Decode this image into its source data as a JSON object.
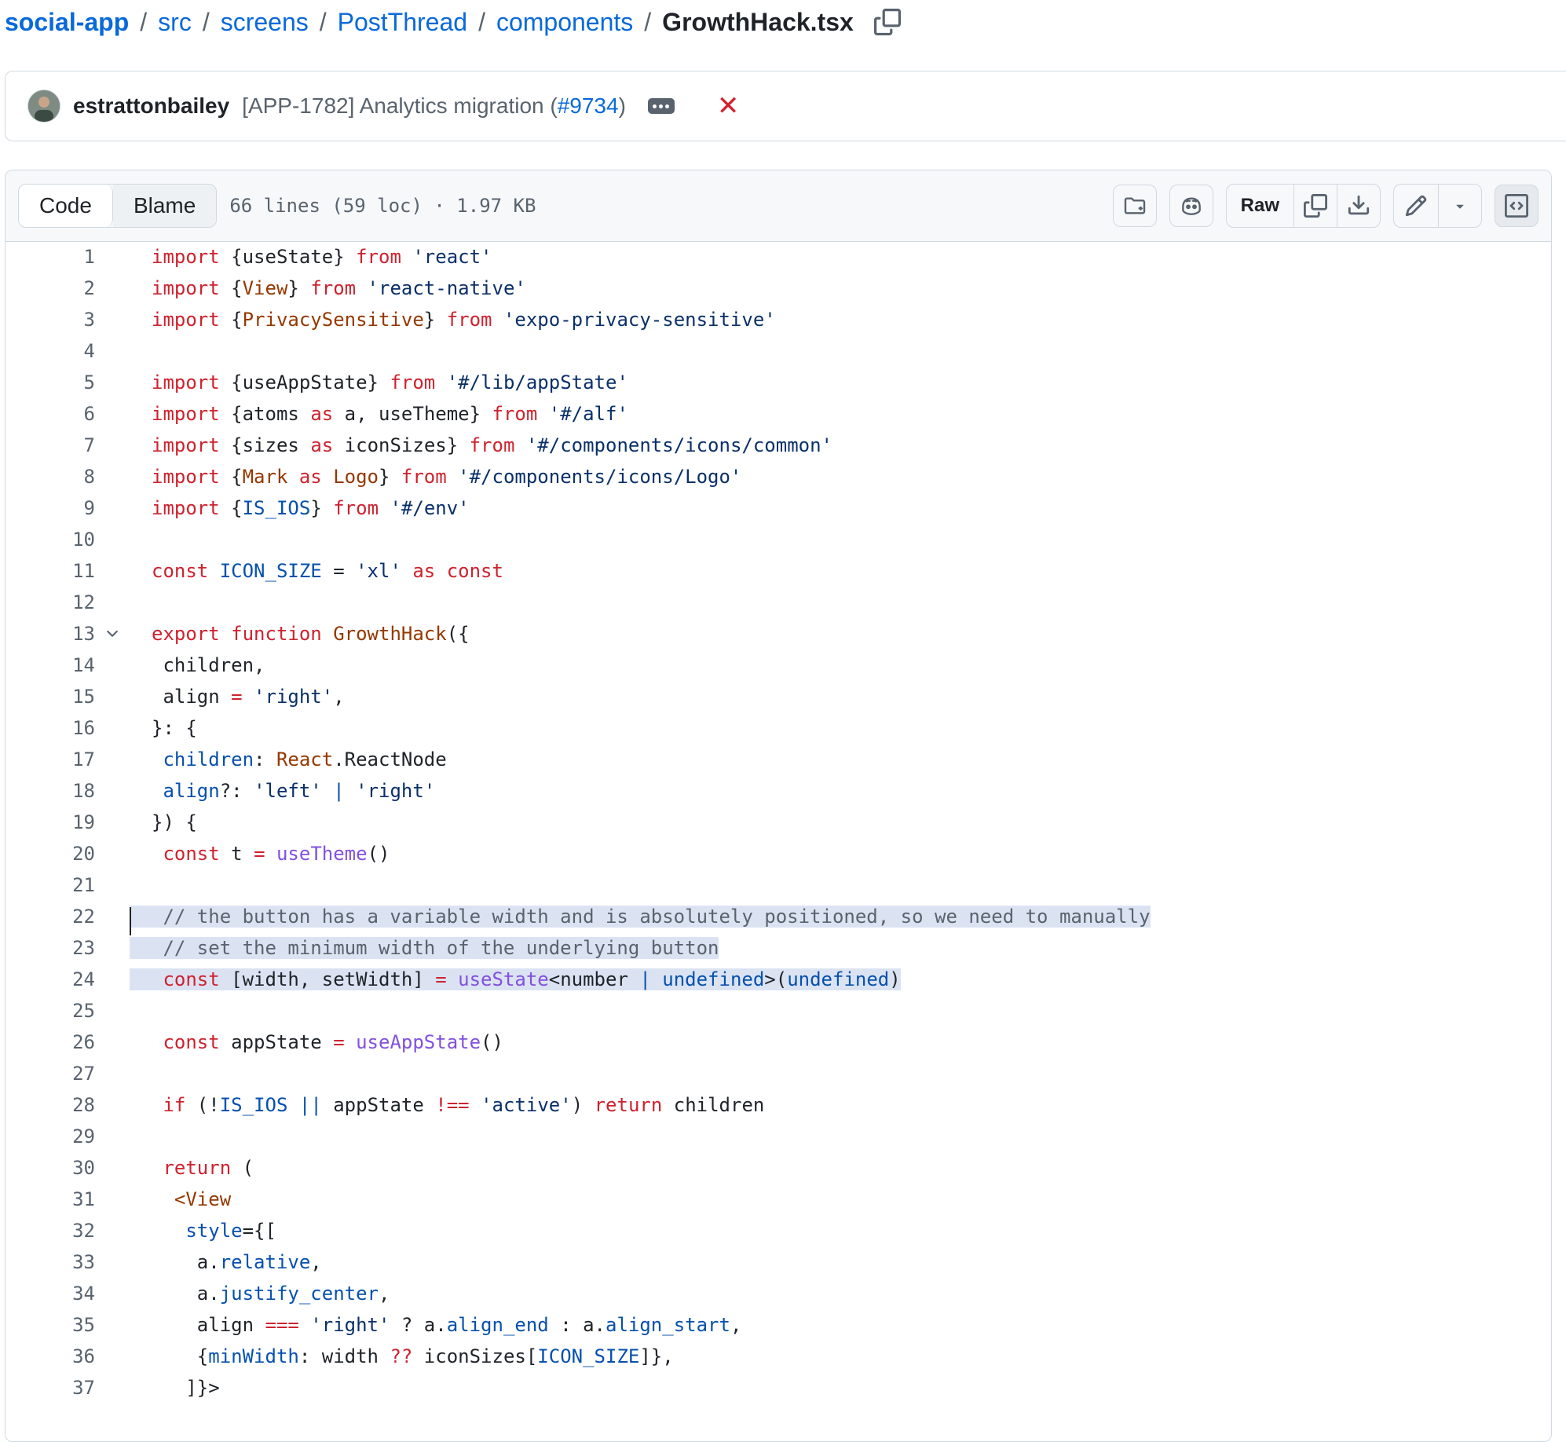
{
  "breadcrumb": {
    "parts": [
      "social-app",
      "src",
      "screens",
      "PostThread",
      "components"
    ],
    "separator": "/",
    "current_file": "GrowthHack.tsx"
  },
  "commit": {
    "author": "estrattonbailey",
    "message": "[APP-1782] Analytics migration (",
    "pr": "#9734",
    "message_end": ")",
    "status": "✕"
  },
  "file_header": {
    "tabs": [
      "Code",
      "Blame"
    ],
    "active_tab": "Code",
    "info": "66 lines (59 loc) · 1.97 KB",
    "raw_label": "Raw"
  },
  "icons": [
    "copy-path-icon",
    "ellipsis-icon",
    "x-icon",
    "add-file-icon",
    "copilot-icon",
    "copy-icon",
    "download-icon",
    "pencil-icon",
    "triangle-down-icon",
    "code-square-icon",
    "chevron-down-icon"
  ],
  "colors": {
    "keyword": "#cf222e",
    "string": "#0a3069",
    "comment": "#59636e",
    "function": "#8250df",
    "variable": "#0550ae",
    "type": "#953800",
    "link": "#0969da",
    "highlight": "#dbe3f3"
  },
  "code": {
    "highlight_lines": [
      22,
      23,
      24
    ],
    "fold_line": 13,
    "lines": [
      [
        [
          "k",
          "import"
        ],
        [
          "",
          "{useState} "
        ],
        [
          "k",
          "from"
        ],
        [
          "",
          ""
        ],
        [
          "s",
          " 'react'"
        ]
      ],
      [
        [
          "k",
          "import"
        ],
        [
          "",
          "{"
        ],
        [
          "t",
          "View"
        ],
        [
          "",
          "} "
        ],
        [
          "k",
          "from"
        ],
        [
          "s",
          " 'react-native'"
        ]
      ],
      [
        [
          "k",
          "import"
        ],
        [
          "",
          "{"
        ],
        [
          "t",
          "PrivacySensitive"
        ],
        [
          "",
          "} "
        ],
        [
          "k",
          "from"
        ],
        [
          "s",
          " 'expo-privacy-sensitive'"
        ]
      ],
      [],
      [
        [
          "k",
          "import"
        ],
        [
          "",
          "{useAppState} "
        ],
        [
          "k",
          "from"
        ],
        [
          "s",
          " '#/lib/appState'"
        ]
      ],
      [
        [
          "k",
          "import"
        ],
        [
          "",
          "{atoms "
        ],
        [
          "k",
          "as"
        ],
        [
          "",
          " a, useTheme} "
        ],
        [
          "k",
          "from"
        ],
        [
          "s",
          " '#/alf'"
        ]
      ],
      [
        [
          "k",
          "import"
        ],
        [
          "",
          "{sizes "
        ],
        [
          "k",
          "as"
        ],
        [
          "",
          " iconSizes} "
        ],
        [
          "k",
          "from"
        ],
        [
          "s",
          " '#/components/icons/common'"
        ]
      ],
      [
        [
          "k",
          "import"
        ],
        [
          "",
          "{"
        ],
        [
          "t",
          "Mark"
        ],
        [
          "k",
          " as "
        ],
        [
          "t",
          "Logo"
        ],
        [
          "",
          "} "
        ],
        [
          "k",
          "from"
        ],
        [
          "s",
          " '#/components/icons/Logo'"
        ]
      ],
      [
        [
          "k",
          "import"
        ],
        [
          "",
          "{"
        ],
        [
          "v",
          "IS_IOS"
        ],
        [
          "",
          "} "
        ],
        [
          "k",
          "from"
        ],
        [
          "s",
          " '#/env'"
        ]
      ],
      [],
      [
        [
          "k",
          "const"
        ],
        [
          "v",
          " ICON_SIZE"
        ],
        [
          "",
          " = "
        ],
        [
          "s",
          "'xl'"
        ],
        [
          "k",
          " as const"
        ]
      ],
      [],
      [
        [
          "k",
          "export function"
        ],
        [
          "t",
          " GrowthHack"
        ],
        [
          "",
          "({"
        ]
      ],
      [
        [
          "",
          " children,"
        ]
      ],
      [
        [
          "",
          " align "
        ],
        [
          "k",
          "="
        ],
        [
          "s",
          " 'right'"
        ],
        [
          "",
          ","
        ]
      ],
      [
        [
          "",
          "}: {"
        ]
      ],
      [
        [
          "v",
          " children"
        ],
        [
          "",
          ": "
        ],
        [
          "t",
          "React"
        ],
        [
          "",
          ".ReactNode"
        ]
      ],
      [
        [
          "v",
          " align"
        ],
        [
          "",
          "?: "
        ],
        [
          "s",
          "'left'"
        ],
        [
          "v",
          " | "
        ],
        [
          "s",
          "'right'"
        ]
      ],
      [
        [
          "",
          "}) {"
        ]
      ],
      [
        [
          "k",
          " const"
        ],
        [
          "",
          " t "
        ],
        [
          "k",
          "="
        ],
        [
          "f",
          " useTheme"
        ],
        [
          "",
          "()"
        ]
      ],
      [],
      [
        [
          "c",
          " // the button has a variable width and is absolutely positioned, so we need to manually"
        ]
      ],
      [
        [
          "c",
          " // set the minimum width of the underlying button"
        ]
      ],
      [
        [
          "k",
          " const"
        ],
        [
          "",
          " [width, setWidth] "
        ],
        [
          "k",
          "="
        ],
        [
          "f",
          " useState"
        ],
        [
          "",
          "<number "
        ],
        [
          "v",
          "| undefined"
        ],
        [
          "",
          ">("
        ],
        [
          "v",
          "undefined"
        ],
        [
          "",
          ")"
        ]
      ],
      [],
      [
        [
          "k",
          " const"
        ],
        [
          "",
          " appState "
        ],
        [
          "k",
          "="
        ],
        [
          "f",
          " useAppState"
        ],
        [
          "",
          "()"
        ]
      ],
      [],
      [
        [
          "k",
          " if"
        ],
        [
          "",
          " (!"
        ],
        [
          "v",
          "IS_IOS"
        ],
        [
          "v",
          " ||"
        ],
        [
          "",
          " appState "
        ],
        [
          "k",
          "!=="
        ],
        [
          "s",
          " 'active'"
        ],
        [
          "",
          ") "
        ],
        [
          "k",
          "return"
        ],
        [
          "",
          " children"
        ]
      ],
      [],
      [
        [
          "k",
          " return"
        ],
        [
          "",
          " ("
        ]
      ],
      [
        [
          "t",
          "  <View"
        ]
      ],
      [
        [
          "v",
          "   style"
        ],
        [
          "",
          "={["
        ]
      ],
      [
        [
          "",
          "    a."
        ],
        [
          "v",
          "relative"
        ],
        [
          "",
          ","
        ]
      ],
      [
        [
          "",
          "    a."
        ],
        [
          "v",
          "justify_center"
        ],
        [
          "",
          ","
        ]
      ],
      [
        [
          "",
          "    align "
        ],
        [
          "k",
          "==="
        ],
        [
          "s",
          " 'right'"
        ],
        [
          "",
          " ? a."
        ],
        [
          "v",
          "align_end"
        ],
        [
          "",
          " : a."
        ],
        [
          "v",
          "align_start"
        ],
        [
          "",
          ","
        ]
      ],
      [
        [
          "",
          "    {"
        ],
        [
          "v",
          "minWidth"
        ],
        [
          "",
          ": width "
        ],
        [
          "k",
          "??"
        ],
        [
          "",
          " iconSizes["
        ],
        [
          "v",
          "ICON_SIZE"
        ],
        [
          "",
          "]},"
        ]
      ],
      [
        [
          "",
          "   ]}>"
        ]
      ]
    ]
  }
}
